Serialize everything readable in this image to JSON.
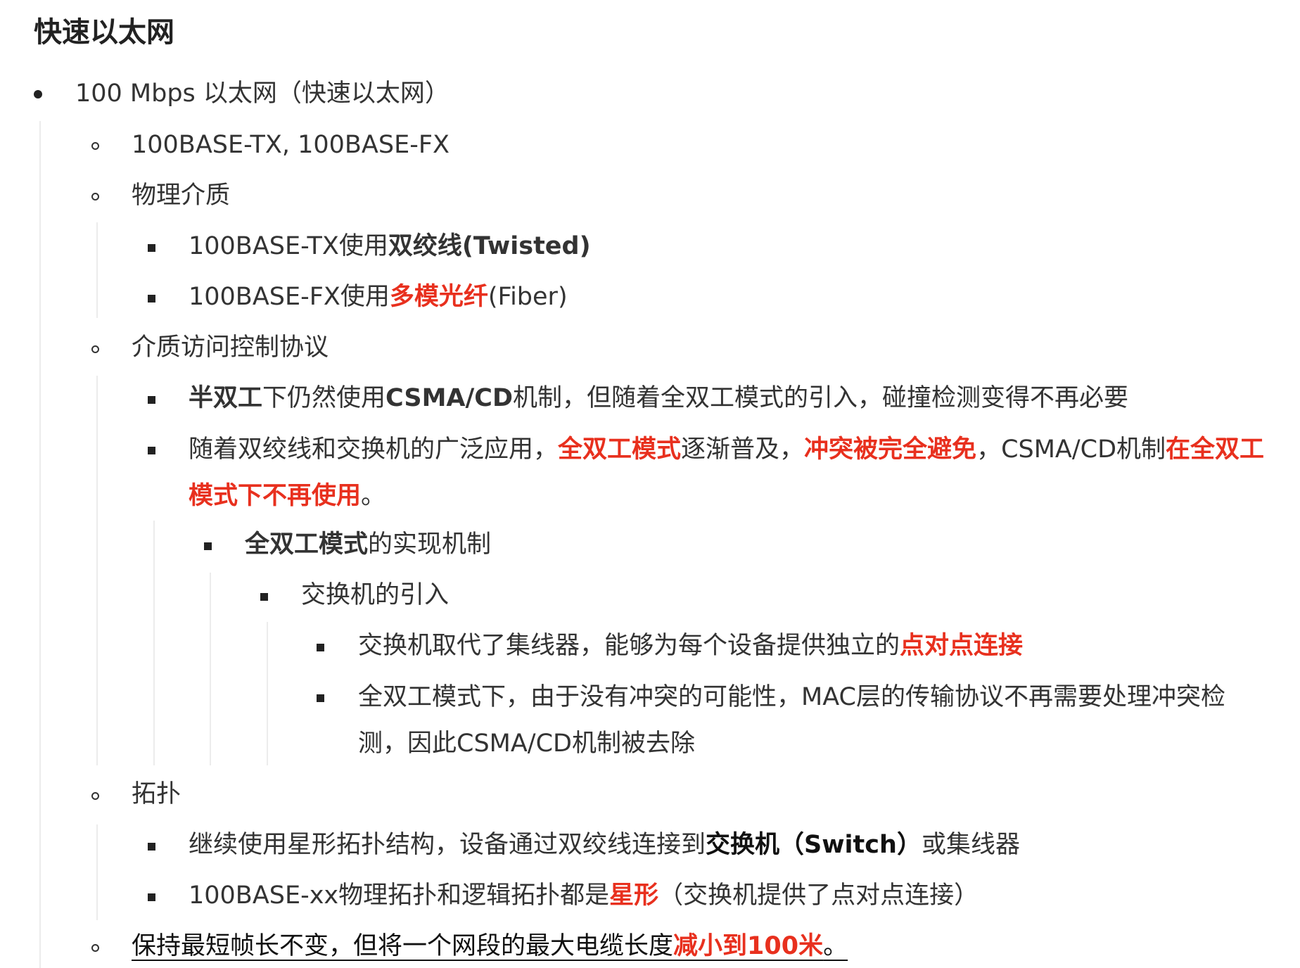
{
  "heading": "快速以太网",
  "l1": "100 Mbps 以太网（快速以太网）",
  "l2a": "100BASE-TX, 100BASE-FX",
  "l2b": "物理介质",
  "l3a": {
    "pre": "100BASE-TX使用",
    "bold": "双绞线(Twisted)"
  },
  "l3b": {
    "pre": "100BASE-FX使用",
    "red": "多模光纤",
    "post": "(Fiber)"
  },
  "l2c": "介质访问控制协议",
  "l3c": {
    "b1": "半双工",
    "t1": "下仍然使用",
    "b2": "CSMA/CD",
    "t2": "机制，但随着全双工模式的引入，碰撞检测变得不再必要"
  },
  "l3d": {
    "t1": "随着双绞线和交换机的广泛应用，",
    "r1": "全双工模式",
    "t2": "逐渐普及，",
    "r2": "冲突被完全避免",
    "t3": "，CSMA/CD机制",
    "r3": "在全双工模式下不再使用",
    "t4": "。"
  },
  "l4a": {
    "b1": "全双工模式",
    "t1": "的实现机制"
  },
  "l5a": "交换机的引入",
  "l6a": {
    "t1": "交换机取代了集线器，能够为每个设备提供独立的",
    "r1": "点对点连接"
  },
  "l6b": "全双工模式下，由于没有冲突的可能性，MAC层的传输协议不再需要处理冲突检测，因此CSMA/CD机制被去除",
  "l2d": "拓扑",
  "l3e": {
    "t1": "继续使用星形拓扑结构，设备通过双绞线连接到",
    "b1": "交换机（Switch）",
    "t2": "或集线器"
  },
  "l3f": {
    "t1": "100BASE-xx物理拓扑和逻辑拓扑都是",
    "r1": "星形",
    "t2": "（交换机提供了点对点连接）"
  },
  "l2e": {
    "t1": "保持最短帧长不变，但将一个网段的最大电缆长度",
    "r1": "减小到100米",
    "t2": "。"
  }
}
